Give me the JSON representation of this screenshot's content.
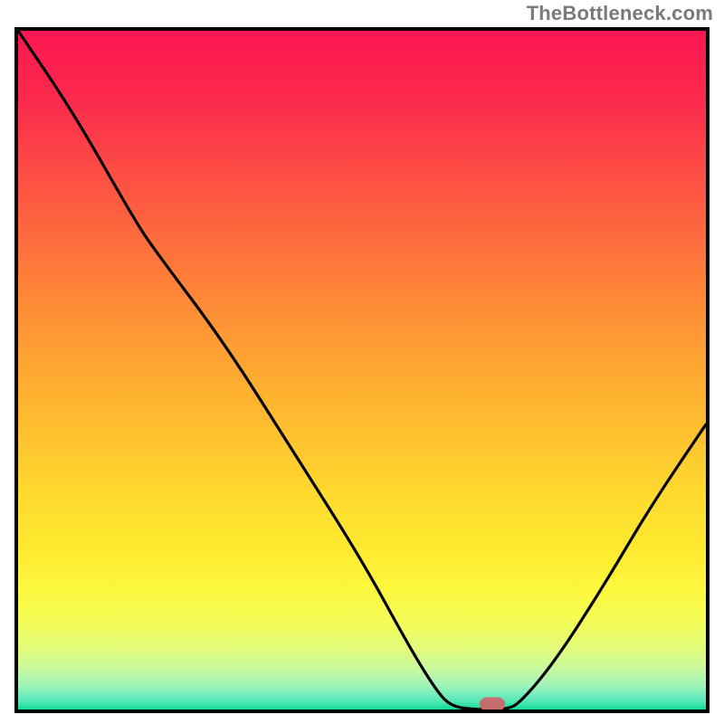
{
  "watermark": "TheBottleneck.com",
  "plot": {
    "inner_w": 760,
    "inner_h": 750
  },
  "gradient_stops": [
    {
      "offset": 0.0,
      "color": "#fb1651"
    },
    {
      "offset": 0.1,
      "color": "#fc2a4c"
    },
    {
      "offset": 0.2,
      "color": "#fd4a45"
    },
    {
      "offset": 0.3,
      "color": "#fd6a3e"
    },
    {
      "offset": 0.4,
      "color": "#fe8a37"
    },
    {
      "offset": 0.5,
      "color": "#fea831"
    },
    {
      "offset": 0.6,
      "color": "#fec22f"
    },
    {
      "offset": 0.68,
      "color": "#fed92e"
    },
    {
      "offset": 0.76,
      "color": "#fee92f"
    },
    {
      "offset": 0.82,
      "color": "#fdf73d"
    },
    {
      "offset": 0.87,
      "color": "#f4fc56"
    },
    {
      "offset": 0.91,
      "color": "#e3fb7b"
    },
    {
      "offset": 0.94,
      "color": "#c7f99d"
    },
    {
      "offset": 0.965,
      "color": "#9ff4b8"
    },
    {
      "offset": 0.985,
      "color": "#5ee9ba"
    },
    {
      "offset": 1.0,
      "color": "#14db9b"
    }
  ],
  "chart_data": {
    "type": "line",
    "title": "",
    "xlabel": "",
    "ylabel": "",
    "xlim": [
      0,
      100
    ],
    "ylim": [
      0,
      100
    ],
    "series": [
      {
        "name": "bottleneck-curve",
        "points": [
          {
            "x": 0.0,
            "y": 100.0
          },
          {
            "x": 8.0,
            "y": 88.0
          },
          {
            "x": 17.0,
            "y": 72.0
          },
          {
            "x": 20.0,
            "y": 67.5
          },
          {
            "x": 30.0,
            "y": 54.0
          },
          {
            "x": 40.0,
            "y": 38.0
          },
          {
            "x": 50.0,
            "y": 22.0
          },
          {
            "x": 57.0,
            "y": 9.0
          },
          {
            "x": 61.0,
            "y": 2.5
          },
          {
            "x": 63.0,
            "y": 0.5
          },
          {
            "x": 66.0,
            "y": 0.0
          },
          {
            "x": 71.0,
            "y": 0.0
          },
          {
            "x": 73.0,
            "y": 1.0
          },
          {
            "x": 78.0,
            "y": 7.0
          },
          {
            "x": 85.0,
            "y": 18.0
          },
          {
            "x": 92.0,
            "y": 30.0
          },
          {
            "x": 100.0,
            "y": 42.0
          }
        ]
      }
    ],
    "marker": {
      "x": 69.0,
      "y": 0.8
    }
  }
}
